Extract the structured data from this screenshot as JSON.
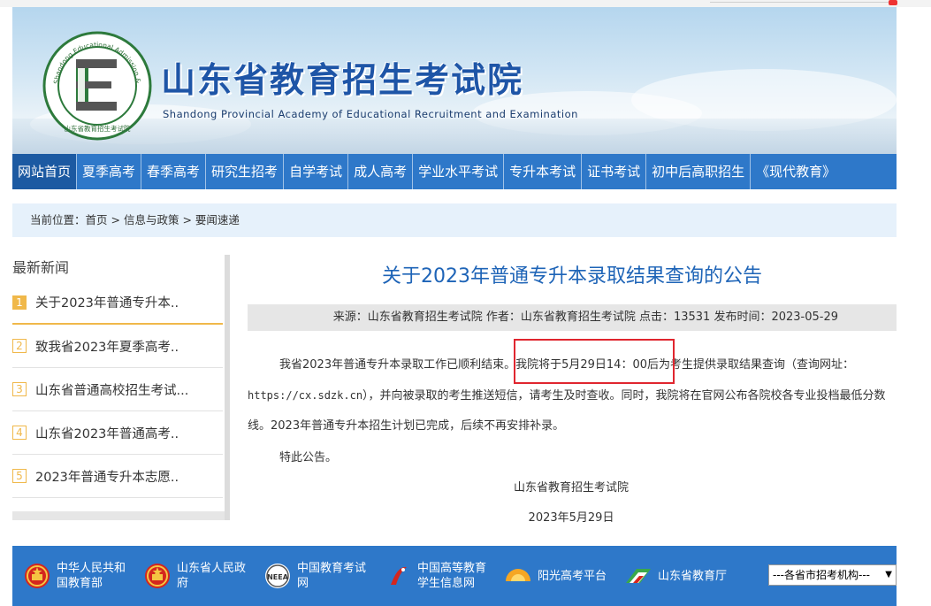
{
  "header": {
    "title": "山东省教育招生考试院",
    "subtitle": "Shandong Provincial Academy of Educational Recruitment and Examination",
    "logo_ring_text": "Shandong Educational Admission & Examinations",
    "logo_bottom_text": "山东省教育招生考试院",
    "logo_letter": "E"
  },
  "nav": {
    "items": [
      {
        "label": "网站首页"
      },
      {
        "label": "夏季高考"
      },
      {
        "label": "春季高考"
      },
      {
        "label": "研究生招考"
      },
      {
        "label": "自学考试"
      },
      {
        "label": "成人高考"
      },
      {
        "label": "学业水平考试"
      },
      {
        "label": "专升本考试"
      },
      {
        "label": "证书考试"
      },
      {
        "label": "初中后高职招生"
      },
      {
        "label": "《现代教育》"
      }
    ]
  },
  "breadcrumb": {
    "prefix": "当前位置：",
    "items": [
      "首页",
      "信息与政策",
      "要闻速递"
    ],
    "separator": " > "
  },
  "sidebar": {
    "title": "最新新闻",
    "items": [
      {
        "num": "1",
        "label": "关于2023年普通专升本.."
      },
      {
        "num": "2",
        "label": "致我省2023年夏季高考.."
      },
      {
        "num": "3",
        "label": "山东省普通高校招生考试..."
      },
      {
        "num": "4",
        "label": "山东省2023年普通高考.."
      },
      {
        "num": "5",
        "label": "2023年普通专升本志愿.."
      }
    ]
  },
  "article": {
    "title": "关于2023年普通专升本录取结果查询的公告",
    "meta": "来源：山东省教育招生考试院 作者：山东省教育招生考试院 点击：13531 发布时间：2023-05-29",
    "para1_a": "我省2023年普通专升本录取工作已顺利结束。我院将于5月29日14：00后为考生提供录取结果查询（查询网址：",
    "para1_url": "https://cx.sdzk.cn",
    "para1_b": "），并向被录取的考生推送短信，请考生及时查收。同时，我院将在官网公布各院校各专业投档最低分数线。2023年普通专升本招生计划已完成，后续不再安排补录。",
    "para2": "特此公告。",
    "signature": "山东省教育招生考试院",
    "date": "2023年5月29日"
  },
  "footer": {
    "links": [
      {
        "label": "中华人民共和国教育部",
        "icon": "emblem-icon"
      },
      {
        "label": "山东省人民政府",
        "icon": "emblem-icon"
      },
      {
        "label": "中国教育考试网",
        "icon": "neea-logo-icon"
      },
      {
        "label": "中国高等教育学生信息网",
        "icon": "chsi-logo-icon"
      },
      {
        "label": "阳光高考平台",
        "icon": "sun-logo-icon"
      },
      {
        "label": "山东省教育厅",
        "icon": "sdedu-logo-icon"
      }
    ],
    "select_value": "---各省市招考机构---"
  },
  "colors": {
    "primary_blue": "#2e78c9",
    "nav_active": "#1c5aa2",
    "title_blue": "#1e64b7",
    "accent_orange": "#f0b84a",
    "highlight_red": "#e0262f"
  }
}
